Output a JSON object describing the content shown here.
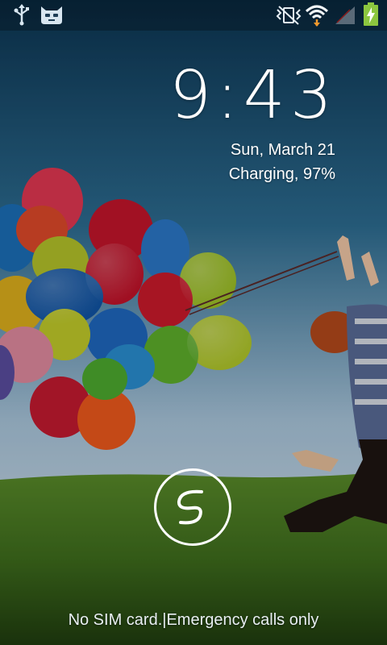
{
  "status_bar": {
    "icons_left": [
      "usb-icon",
      "cyanogenmod-icon"
    ],
    "icons_right": [
      "vibrate-icon",
      "wifi-icon",
      "signal-icon",
      "battery-charging-icon"
    ],
    "battery_color": "#8cc63f"
  },
  "lockscreen": {
    "time": "9:43",
    "date": "Sun, March 21",
    "charging": "Charging, 97%",
    "carrier": "No SIM card.|Emergency calls only"
  },
  "colors": {
    "sky_top": "#0f3f5f",
    "sky_bottom": "#dbe7f2",
    "grass": "#4a7e22"
  }
}
